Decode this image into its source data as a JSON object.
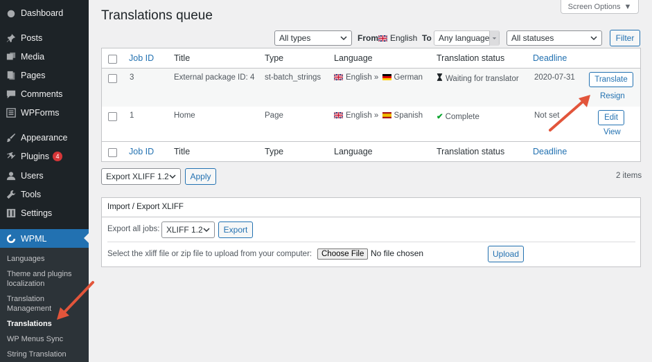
{
  "sidebar": {
    "items": [
      {
        "label": "Dashboard",
        "icon": "dashboard-icon"
      },
      {
        "label": "Posts",
        "icon": "pin-icon"
      },
      {
        "label": "Media",
        "icon": "media-icon"
      },
      {
        "label": "Pages",
        "icon": "pages-icon"
      },
      {
        "label": "Comments",
        "icon": "comment-icon"
      },
      {
        "label": "WPForms",
        "icon": "forms-icon"
      },
      {
        "label": "Appearance",
        "icon": "brush-icon"
      },
      {
        "label": "Plugins",
        "icon": "plugin-icon",
        "badge": "4"
      },
      {
        "label": "Users",
        "icon": "user-icon"
      },
      {
        "label": "Tools",
        "icon": "wrench-icon"
      },
      {
        "label": "Settings",
        "icon": "settings-icon"
      },
      {
        "label": "WPML",
        "icon": "wpml-icon"
      }
    ],
    "submenu": [
      {
        "label": "Languages"
      },
      {
        "label": "Theme and plugins localization"
      },
      {
        "label": "Translation Management"
      },
      {
        "label": "Translations"
      },
      {
        "label": "WP Menus Sync"
      },
      {
        "label": "String Translation"
      }
    ]
  },
  "header": {
    "screen_options": "Screen Options",
    "title": "Translations queue"
  },
  "filters": {
    "type": "All types",
    "from_label": "From",
    "from_value": "English",
    "to_label": "To",
    "to_value": "Any language",
    "status": "All statuses",
    "filter_button": "Filter"
  },
  "table": {
    "columns": [
      "Job ID",
      "Title",
      "Type",
      "Language",
      "Translation status",
      "Deadline"
    ],
    "rows": [
      {
        "id": "3",
        "title": "External package ID: 4",
        "type": "st-batch_strings",
        "from": "English",
        "sep": "»",
        "to": "German",
        "status": "Waiting for translator",
        "deadline": "2020-07-31",
        "action": "Translate",
        "secondary": "Resign"
      },
      {
        "id": "1",
        "title": "Home",
        "type": "Page",
        "from": "English",
        "sep": "»",
        "to": "Spanish",
        "status": "Complete",
        "deadline": "Not set",
        "action": "Edit",
        "secondary": "View"
      }
    ]
  },
  "bulk": {
    "export_select": "Export XLIFF 1.2",
    "apply": "Apply",
    "items_count": "2 items"
  },
  "xliff": {
    "heading": "Import / Export XLIFF",
    "export_all_label": "Export all jobs:",
    "export_format": "XLIFF 1.2",
    "export_button": "Export",
    "upload_label": "Select the xliff file or zip file to upload from your computer:",
    "choose_file": "Choose File",
    "no_file": "No file chosen",
    "upload_button": "Upload"
  },
  "colors": {
    "sidebar_bg": "#1d2327",
    "accent": "#2271b1",
    "annotation": "#e2553b",
    "badge": "#d63638"
  }
}
